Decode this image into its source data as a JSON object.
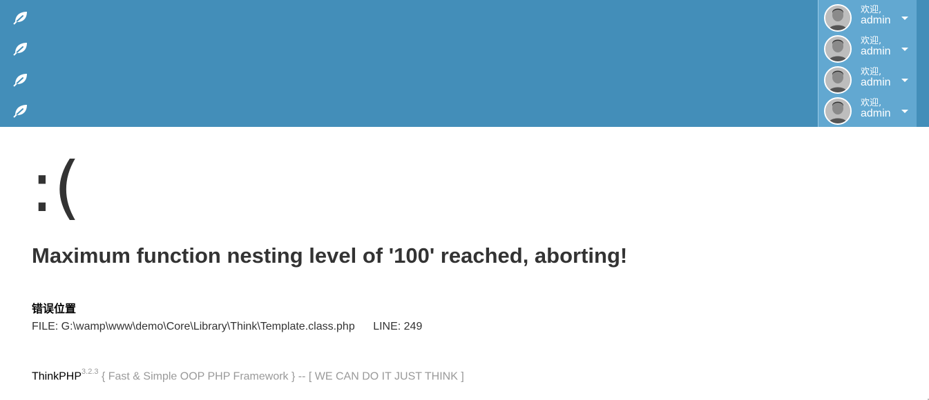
{
  "header": {
    "background": "#438eb9",
    "leaf_icons": [
      "leaf-icon",
      "leaf-icon",
      "leaf-icon",
      "leaf-icon"
    ],
    "user_panel_color": "#62a8d1",
    "users": [
      {
        "welcome": "欢迎,",
        "name": "admin"
      },
      {
        "welcome": "欢迎,",
        "name": "admin"
      },
      {
        "welcome": "欢迎,",
        "name": "admin"
      },
      {
        "welcome": "欢迎,",
        "name": "admin"
      }
    ]
  },
  "error": {
    "face": ":(",
    "message": "Maximum function nesting level of '100' reached, aborting!",
    "location_title": "错误位置",
    "file_text": "FILE: G:\\wamp\\www\\demo\\Core\\Library\\Think\\Template.class.php",
    "line_text": "LINE: 249"
  },
  "footer": {
    "brand": "ThinkPHP",
    "version": "3.2.3",
    "tagline": " { Fast & Simple OOP PHP Framework } -- [ WE CAN DO IT JUST THINK ]"
  }
}
